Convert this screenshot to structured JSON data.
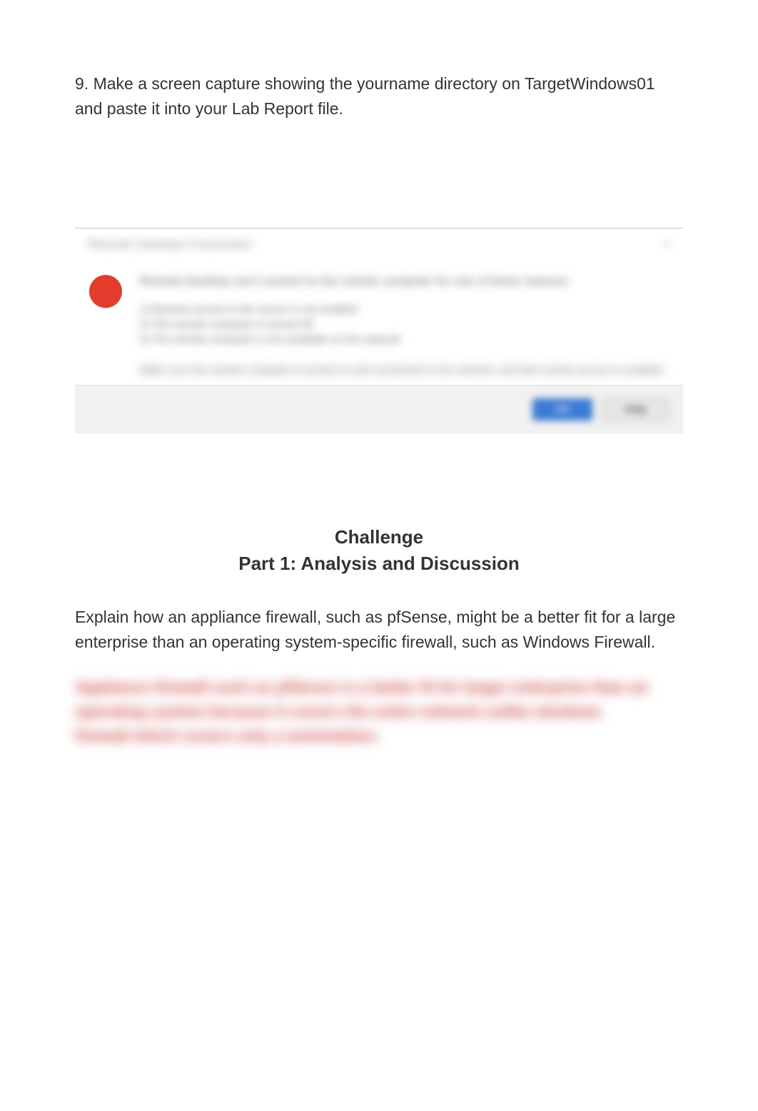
{
  "instruction": "9. Make a screen capture showing the yourname directory on TargetWindows01 and paste it into your Lab Report file.",
  "dialog": {
    "title": "Remote Desktop Connection",
    "close": "×",
    "heading": "Remote Desktop can't connect to the remote computer for one of these reasons:",
    "details_line1": "1) Remote access to the server is not enabled",
    "details_line2": "2) The remote computer is turned off",
    "details_line3": "3) The remote computer is not available on the network",
    "footer_text": "Make sure the remote computer is turned on and connected to the network, and that remote access is enabled.",
    "ok_label": "OK",
    "help_label": "Help"
  },
  "section": {
    "title": "Challenge",
    "subtitle": "Part 1: Analysis and Discussion"
  },
  "question": "Explain how an appliance firewall, such as pfSense, might be a better fit for a large enterprise than an operating system-specific firewall, such as Windows Firewall.",
  "answer_blurred": "Appliance firewall such as pfSense is a better fit for larger enterprise than an operating system because it covers the entire network unlike windows firewall which covers only a workstation."
}
